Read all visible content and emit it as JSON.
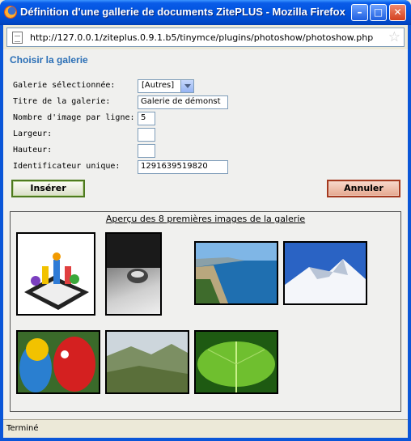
{
  "window": {
    "title": "Définition d'une gallerie de documents ZitePLUS - Mozilla Firefox",
    "minimize": "–",
    "maximize": "□",
    "close": "✕"
  },
  "address": {
    "url": "http://127.0.0.1/ziteplus.0.9.1.b5/tinymce/plugins/photoshow/photoshow.php"
  },
  "form": {
    "heading": "Choisir la galerie",
    "gallery_label": "Galerie sélectionnée:",
    "gallery_value": "[Autres]",
    "title_label": "Titre de la galerie:",
    "title_value": "Galerie de démonst",
    "per_line_label": "Nombre d'image par ligne:",
    "per_line_value": "5",
    "width_label": "Largeur:",
    "width_value": "",
    "height_label": "Hauteur:",
    "height_value": "",
    "id_label": "Identificateur unique:",
    "id_value": "1291639519820"
  },
  "buttons": {
    "insert": "Insérer",
    "cancel": "Annuler"
  },
  "gallery": {
    "title": "Aperçu des 8 premières images de la galerie",
    "images": [
      "chess-pieces",
      "water-drop",
      "coast-city",
      "snowy-mountains",
      "parrots",
      "valley-landscape",
      "green-leaf"
    ]
  },
  "status": {
    "text": "Terminé"
  },
  "colors": {
    "heading": "#2b6fb6",
    "titlebar": "#0052de"
  }
}
